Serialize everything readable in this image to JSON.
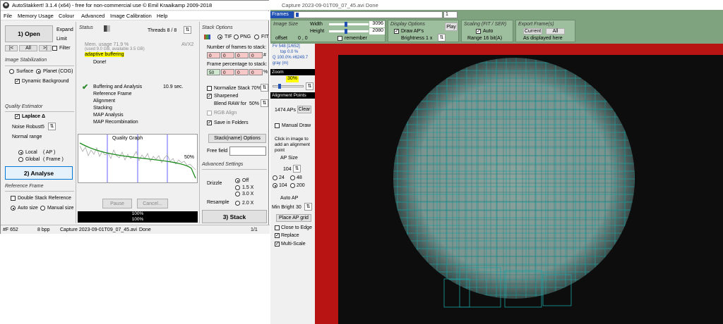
{
  "main_window": {
    "title": "AutoStakkert! 3.1.4 (x64) - free for non-commercial use © Emil Kraaikamp 2009-2018",
    "menu": [
      "File",
      "Memory Usage",
      "Colour",
      "Advanced",
      "Image Calibration",
      "Help"
    ],
    "open_button": "1) Open",
    "expand": "Expand",
    "limit": "Limit",
    "nav": {
      "prev": "|<",
      "all": "All",
      ">|": ">|",
      "filter": "Filter"
    },
    "image_stabilization": {
      "title": "Image Stabilization",
      "surface": "Surface",
      "planet": "Planet (COG)",
      "dynamic_background": "Dynamic Background"
    },
    "quality_estimator": {
      "title": "Quality Estimator",
      "laplace": "Laplace Δ",
      "noise_robust": "Noise Robust",
      "noise_value": "5",
      "normal_range": "Normal range",
      "local": "Local",
      "local_ap": "( AP )",
      "global": "Global",
      "global_frame": "( Frame )"
    },
    "analyse_button": "2) Analyse",
    "reference_frame": {
      "title": "Reference Frame",
      "double_stack": "Double Stack Reference",
      "auto_size": "Auto size",
      "manual_size": "Manual size"
    },
    "status": {
      "title": "Status",
      "threads": "Threads 8 / 8",
      "memory": "Mem. usage 71.9 %",
      "memory_detail": "(used 9.0 GB, available 3.5 GB)",
      "avx": "AVX2",
      "adaptive": "adaptive buffering",
      "done": "Done!",
      "steps": [
        "Buffering and Analysis",
        "Reference Frame",
        "Alignment",
        "Stacking",
        "MAP Analysis",
        "MAP Recombination"
      ],
      "time": "10.9 sec.",
      "quality_graph": "Quality Graph",
      "quality_pct": "50%",
      "pause": "Pause",
      "cancel": "Cancel...",
      "progress1": "100%",
      "progress2": "100%"
    },
    "stack_options": {
      "title": "Stack Options",
      "tif": "TIF",
      "png": "PNG",
      "fit": "FIT",
      "num_frames_label": "Number of frames to stack:",
      "num_frames": [
        "0",
        "0",
        "0",
        "0"
      ],
      "num_suffix": "#",
      "pct_label": "Frame percentage to stack:",
      "pct_frames": [
        "50",
        "0",
        "0",
        "0"
      ],
      "pct_suffix": "%",
      "normalize": "Normalize Stack 70%",
      "sharpened": "Sharpened",
      "blend": "Blend RAW for",
      "blend_pct": "50%",
      "rgb_align": "RGB Align",
      "save_folders": "Save in Folders",
      "stack_name_button": "Stack(name) Options",
      "free_field": "Free field"
    },
    "advanced_settings": {
      "title": "Advanced Settings",
      "drizzle": "Drizzle",
      "off": "Off",
      "d15": "1.5 X",
      "d30": "3.0 X",
      "resample": "Resample",
      "r20": "2.0 X"
    },
    "stack_button": "3) Stack",
    "statusbar": {
      "frames": "#F 652",
      "bpp": "8 bpp",
      "file": "Capture 2023-09-01T09_07_45.avi",
      "state": "Done",
      "page": "1/1"
    }
  },
  "capture_window": {
    "title": "Capture 2023-09-01T09_07_45.avi   Done",
    "frames_label": "Frames",
    "frame_value": "1",
    "image_size": {
      "title": "Image Size",
      "width_label": "Width",
      "width": "3096",
      "height_label": "Height",
      "height": "2080",
      "offset": "offset",
      "offset_val": "0 , 0",
      "remember": "remember"
    },
    "display_options": {
      "title": "Display Options",
      "draw_aps": "Draw AP's",
      "brightness": "Brightness 1 x",
      "play": "Play"
    },
    "scaling": {
      "title": "Scaling (FIT / SER)",
      "auto": "Auto",
      "range": "Range 16 bit(A)"
    },
    "export": {
      "title": "Export Frame(s)",
      "current": "Current",
      "all": "All",
      "as_displayed": "As displayed here"
    },
    "side": {
      "frame_info": "F# 548 [1/652]",
      "top": "top 0.0 %",
      "q": "Q 100.0%  #6249.7",
      "gray": "gray (m)",
      "zoom": "Zoom",
      "zoom_val": "30%",
      "alignment_points": "Alignment Points",
      "aps_count": "1474 APs",
      "clear": "Clear",
      "manual_draw": "Manual Draw",
      "click_hint": "Click in image to add an alignment point",
      "ap_size": "AP Size",
      "ap_size_val": "104",
      "s24": "24",
      "s48": "48",
      "s104": "104",
      "s200": "200",
      "auto_ap": "Auto AP",
      "min_bright": "Min Bright",
      "min_bright_val": "30",
      "place_grid": "Place AP grid",
      "close_edge": "Close to Edge",
      "replace": "Replace",
      "multiscale": "Multi-Scale"
    }
  }
}
